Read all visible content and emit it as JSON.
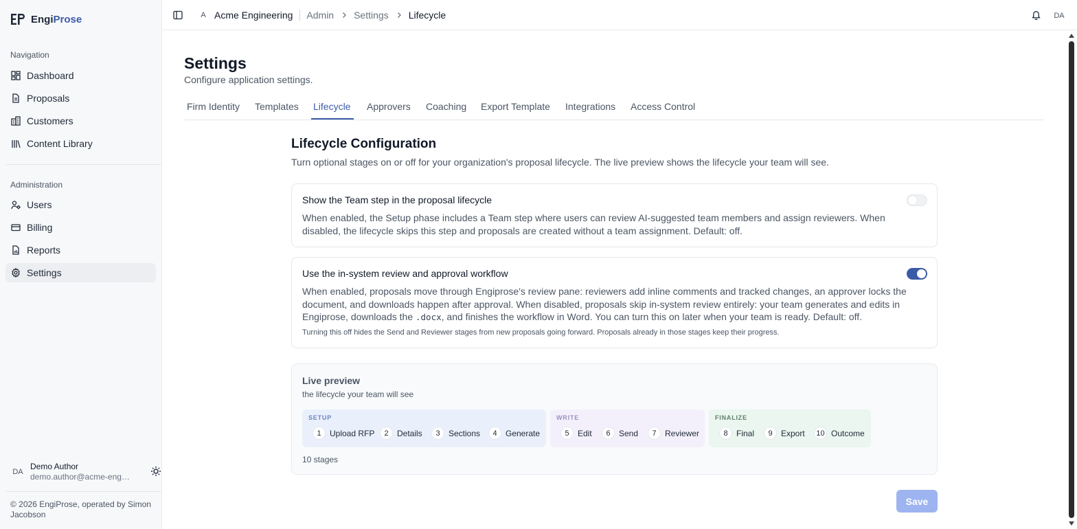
{
  "brand": {
    "prefix": "Engi",
    "suffix": "Prose"
  },
  "sidebar": {
    "nav_label": "Navigation",
    "nav_items": [
      {
        "label": "Dashboard",
        "icon": "dashboard-icon"
      },
      {
        "label": "Proposals",
        "icon": "document-icon"
      },
      {
        "label": "Customers",
        "icon": "building-icon"
      },
      {
        "label": "Content Library",
        "icon": "library-icon"
      }
    ],
    "admin_label": "Administration",
    "admin_items": [
      {
        "label": "Users",
        "icon": "users-icon"
      },
      {
        "label": "Billing",
        "icon": "credit-card-icon"
      },
      {
        "label": "Reports",
        "icon": "report-icon"
      },
      {
        "label": "Settings",
        "icon": "gear-icon",
        "active": true
      }
    ],
    "user": {
      "initials": "DA",
      "name": "Demo Author",
      "email": "demo.author@acme-engineering.com"
    },
    "footer": "© 2026 EngiProse, operated by Simon Jacobson"
  },
  "topbar": {
    "org_initial": "A",
    "org_name": "Acme Engineering",
    "breadcrumbs": [
      "Admin",
      "Settings",
      "Lifecycle"
    ],
    "user_initials": "DA"
  },
  "page": {
    "title": "Settings",
    "subtitle": "Configure application settings.",
    "tabs": [
      "Firm Identity",
      "Templates",
      "Lifecycle",
      "Approvers",
      "Coaching",
      "Export Template",
      "Integrations",
      "Access Control"
    ],
    "active_tab": "Lifecycle"
  },
  "lifecycle": {
    "title": "Lifecycle Configuration",
    "description": "Turn optional stages on or off for your organization's proposal lifecycle. The live preview shows the lifecycle your team will see.",
    "team_step": {
      "title": "Show the Team step in the proposal lifecycle",
      "body": "When enabled, the Setup phase includes a Team step where users can review AI-suggested team members and assign reviewers. When disabled, the lifecycle skips this step and proposals are created without a team assignment. Default: off.",
      "enabled": false
    },
    "review_workflow": {
      "title": "Use the in-system review and approval workflow",
      "body_before": "When enabled, proposals move through Engiprose's review pane: reviewers add inline comments and tracked changes, an approver locks the document, and downloads happen after approval. When disabled, proposals skip in-system review entirely: your team generates and edits in Engiprose, downloads the",
      "body_code": ".docx",
      "body_after": ", and finishes the workflow in Word. You can turn this on later when your team is ready. Default: off.",
      "note": "Turning this off hides the Send and Reviewer stages from new proposals going forward. Proposals already in those stages keep their progress.",
      "enabled": true
    },
    "preview": {
      "title": "Live preview",
      "subtitle": "the lifecycle your team will see",
      "groups": [
        {
          "label": "SETUP",
          "steps": [
            {
              "num": "1",
              "label": "Upload RFP"
            },
            {
              "num": "2",
              "label": "Details"
            },
            {
              "num": "3",
              "label": "Sections"
            },
            {
              "num": "4",
              "label": "Generate"
            }
          ]
        },
        {
          "label": "WRITE",
          "steps": [
            {
              "num": "5",
              "label": "Edit"
            },
            {
              "num": "6",
              "label": "Send"
            },
            {
              "num": "7",
              "label": "Reviewer"
            }
          ]
        },
        {
          "label": "FINALIZE",
          "steps": [
            {
              "num": "8",
              "label": "Final"
            },
            {
              "num": "9",
              "label": "Export"
            },
            {
              "num": "10",
              "label": "Outcome"
            }
          ]
        }
      ],
      "stage_count": "10 stages"
    },
    "save_label": "Save"
  },
  "colors": {
    "accent": "#3b5ba9",
    "setup_bg": "#eaf0fb",
    "write_bg": "#f3f0fb",
    "finalize_bg": "#eaf6ef",
    "save_disabled": "#9db4f0"
  }
}
